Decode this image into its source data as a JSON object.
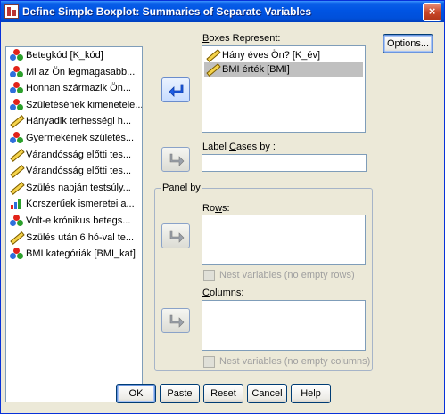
{
  "window": {
    "title": "Define Simple Boxplot: Summaries of Separate Variables",
    "close_glyph": "×"
  },
  "source_list": {
    "items": [
      {
        "label": "Betegkód [K_kód]",
        "icon": "nominal-icon"
      },
      {
        "label": "Mi az Ön legmagasabb...",
        "icon": "nominal-icon"
      },
      {
        "label": "Honnan származik Ön...",
        "icon": "nominal-icon"
      },
      {
        "label": "Születésének kimenetele...",
        "icon": "nominal-icon"
      },
      {
        "label": "Hányadik terhességi h...",
        "icon": "scale-icon"
      },
      {
        "label": "Gyermekének születés...",
        "icon": "nominal-icon"
      },
      {
        "label": "Várandósság előtti tes...",
        "icon": "scale-icon"
      },
      {
        "label": "Várandósság előtti tes...",
        "icon": "scale-icon"
      },
      {
        "label": "Szülés napján testsúly...",
        "icon": "scale-icon"
      },
      {
        "label": "Korszerűek ismeretei a...",
        "icon": "ordinal-icon"
      },
      {
        "label": "Volt-e krónikus betegs...",
        "icon": "nominal-icon"
      },
      {
        "label": "Szülés után 6 hó-val te...",
        "icon": "scale-icon"
      },
      {
        "label": "BMI kategóriák [BMI_kat]",
        "icon": "nominal-icon"
      }
    ]
  },
  "boxes_represent": {
    "label_pre": "",
    "label_key": "B",
    "label_post": "oxes Represent:",
    "items": [
      {
        "label": "Hány éves Ön? [K_év]",
        "icon": "scale-icon",
        "selected": false
      },
      {
        "label": "BMI érték [BMI]",
        "icon": "scale-icon",
        "selected": true
      }
    ]
  },
  "label_cases": {
    "label_pre": "Label ",
    "label_key": "C",
    "label_post": "ases by :",
    "value": ""
  },
  "panel_by": {
    "legend": "Panel by",
    "rows_pre": "Ro",
    "rows_key": "w",
    "rows_post": "s:",
    "rows_nest": "Nest variables (no empty rows)",
    "columns_pre": "",
    "columns_key": "C",
    "columns_post": "olumns:",
    "columns_nest": "Nest variables (no empty columns)"
  },
  "buttons": {
    "options": "Options...",
    "ok": "OK",
    "paste": "Paste",
    "reset": "Reset",
    "cancel": "Cancel",
    "help": "Help"
  }
}
